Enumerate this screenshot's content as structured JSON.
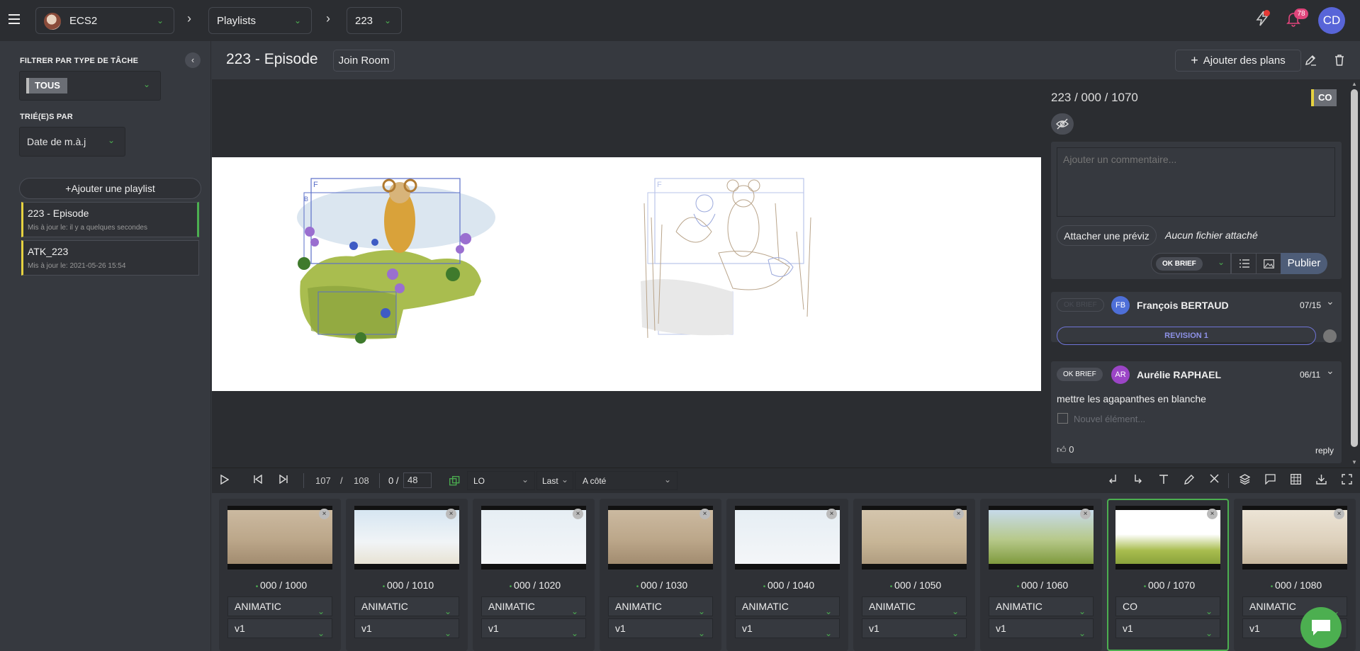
{
  "topbar": {
    "production": "ECS2",
    "section": "Playlists",
    "episode": "223",
    "news_count": "",
    "notif_count": "78",
    "user_initials": "CD"
  },
  "sidebar": {
    "filter_label": "FILTRER PAR TYPE DE TÂCHE",
    "filter_value": "TOUS",
    "sort_label": "TRIÉ(E)S PAR",
    "sort_value": "Date de m.à.j",
    "add_playlist": "Ajouter une playlist",
    "playlists": [
      {
        "title": "223 - Episode",
        "updated": "Mis à jour le: il y a quelques secondes"
      },
      {
        "title": "ATK_223",
        "updated": "Mis à jour le: 2021-05-26 15:54"
      }
    ]
  },
  "main": {
    "title": "223 - Episode",
    "join_room": "Join Room",
    "add_shots": "Ajouter des plans"
  },
  "panel": {
    "shot": "223 / 000 / 1070",
    "task_badge": "CO",
    "comment_placeholder": "Ajouter un commentaire...",
    "attach_button": "Attacher une préviz",
    "no_file": "Aucun fichier attaché",
    "status_select": "OK BRIEF",
    "publish": "Publier",
    "comments": [
      {
        "status": "OK BRIEF",
        "initials": "FB",
        "author": "François BERTAUD",
        "date": "07/15",
        "revision": "REVISION 1"
      },
      {
        "status": "OK BRIEF",
        "initials": "AR",
        "author": "Aurélie RAPHAEL",
        "date": "06/11",
        "text": "mettre les agapanthes en blanche",
        "checklist_placeholder": "Nouvel élément...",
        "likes": "0",
        "reply": "reply"
      }
    ]
  },
  "player": {
    "current_frame": "107",
    "frame_sep": "/",
    "total_frames": "108",
    "counter": "0 /",
    "counter_total": "48",
    "task_type": "LO",
    "version_mode": "Last",
    "compare_mode": "A côté"
  },
  "thumbnails": [
    {
      "name": "000 / 1000",
      "task": "ANIMATIC",
      "version": "v1",
      "style": "sepia"
    },
    {
      "name": "000 / 1010",
      "task": "ANIMATIC",
      "version": "v1",
      "style": "sky"
    },
    {
      "name": "000 / 1020",
      "task": "ANIMATIC",
      "version": "v1",
      "style": "sketch"
    },
    {
      "name": "000 / 1030",
      "task": "ANIMATIC",
      "version": "v1",
      "style": "sepia"
    },
    {
      "name": "000 / 1040",
      "task": "ANIMATIC",
      "version": "v1",
      "style": "sketch"
    },
    {
      "name": "000 / 1050",
      "task": "ANIMATIC",
      "version": "v1",
      "style": "sepia2"
    },
    {
      "name": "000 / 1060",
      "task": "ANIMATIC",
      "version": "v1",
      "style": "color"
    },
    {
      "name": "000 / 1070",
      "task": "CO",
      "version": "v1",
      "style": "bright",
      "selected": true
    },
    {
      "name": "000 / 1080",
      "task": "ANIMATIC",
      "version": "v1",
      "style": "sepia3"
    }
  ],
  "colors": {
    "accent": "#4caf50",
    "panel": "#2b2d31",
    "bg": "#36393f",
    "avatar": "#5865d8"
  }
}
